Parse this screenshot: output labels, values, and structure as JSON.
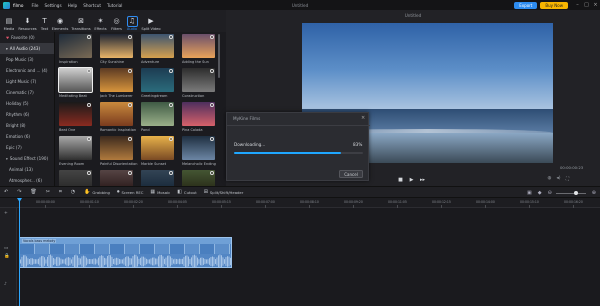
{
  "app": {
    "name": "filmo",
    "menu": [
      "File",
      "Settings",
      "Help",
      "Shortcut",
      "Tutorial"
    ],
    "window_title": "Untitled",
    "export_label": "Export",
    "buy_label": "Buy Now",
    "accent": "#2d8cf0",
    "buy_color": "#f7b500"
  },
  "toolbar": {
    "items": [
      {
        "label": "Media",
        "icon": "folder-icon"
      },
      {
        "label": "Resources",
        "icon": "download-icon"
      },
      {
        "label": "Text",
        "icon": "text-icon"
      },
      {
        "label": "Elements",
        "icon": "elements-icon"
      },
      {
        "label": "Transitions",
        "icon": "transitions-icon"
      },
      {
        "label": "Effects",
        "icon": "effects-icon"
      },
      {
        "label": "Filters",
        "icon": "filters-icon"
      },
      {
        "label": "Audio",
        "icon": "music-note-icon"
      },
      {
        "label": "Split Video",
        "icon": "split-icon"
      }
    ],
    "active": "Audio"
  },
  "sidebar": {
    "items": [
      {
        "label": "Favorite (0)",
        "icon": "heart-icon"
      },
      {
        "label": "All Audio (243)",
        "arrow": "▾",
        "selected": true
      },
      {
        "label": "Pop Music (3)"
      },
      {
        "label": "Electronic and ... (4)"
      },
      {
        "label": "Light Music (7)"
      },
      {
        "label": "Cinematic (7)"
      },
      {
        "label": "Holiday (5)"
      },
      {
        "label": "Rhythm (6)"
      },
      {
        "label": "Bright (8)"
      },
      {
        "label": "Emotion (6)"
      },
      {
        "label": "Epic (7)"
      },
      {
        "label": "Sound Effect (190)",
        "arrow": "▾"
      },
      {
        "label": "Animal (13)",
        "indent": true
      },
      {
        "label": "Atmospher... (6)",
        "indent": true
      }
    ]
  },
  "media_tiles": [
    {
      "name": "Inspiration"
    },
    {
      "name": "City Sunshine"
    },
    {
      "name": "Adventure"
    },
    {
      "name": "Adding the Sun"
    },
    {
      "name": "Meditating Beat"
    },
    {
      "name": "Jack The Lumberer"
    },
    {
      "name": "Greetingdream"
    },
    {
      "name": "Construction"
    },
    {
      "name": "Beat One"
    },
    {
      "name": "Romantic Inspiration"
    },
    {
      "name": "Pond"
    },
    {
      "name": "Pina Colada"
    },
    {
      "name": "Evening Room"
    },
    {
      "name": "Painful Disorientation"
    },
    {
      "name": "Marble Sunset"
    },
    {
      "name": "Melancholic Ending"
    },
    {
      "name": ""
    },
    {
      "name": ""
    },
    {
      "name": ""
    },
    {
      "name": ""
    }
  ],
  "dialog": {
    "title": "MyKine Films",
    "label": "Downloading...",
    "percent_text": "83%",
    "progress": 0.83,
    "cancel": "Cancel"
  },
  "preview": {
    "timecode": "00:00:00:23"
  },
  "timeline": {
    "tools": [
      "Grabbing",
      "Screen REC",
      "Mosaic",
      "Cutout",
      "Split/Shift/Header"
    ],
    "ruler": [
      "00:00:00:00",
      "00:00:01:10",
      "00:00:02:20",
      "00:00:04:05",
      "00:00:05:15",
      "00:00:07:00",
      "00:00:08:10",
      "00:00:09:20",
      "00:00:11:05",
      "00:00:12:15",
      "00:00:14:00",
      "00:00:15:10",
      "00:00:16:20"
    ],
    "clip_label": "Vocals bass melody",
    "clip_color": "#6fa0d6"
  }
}
